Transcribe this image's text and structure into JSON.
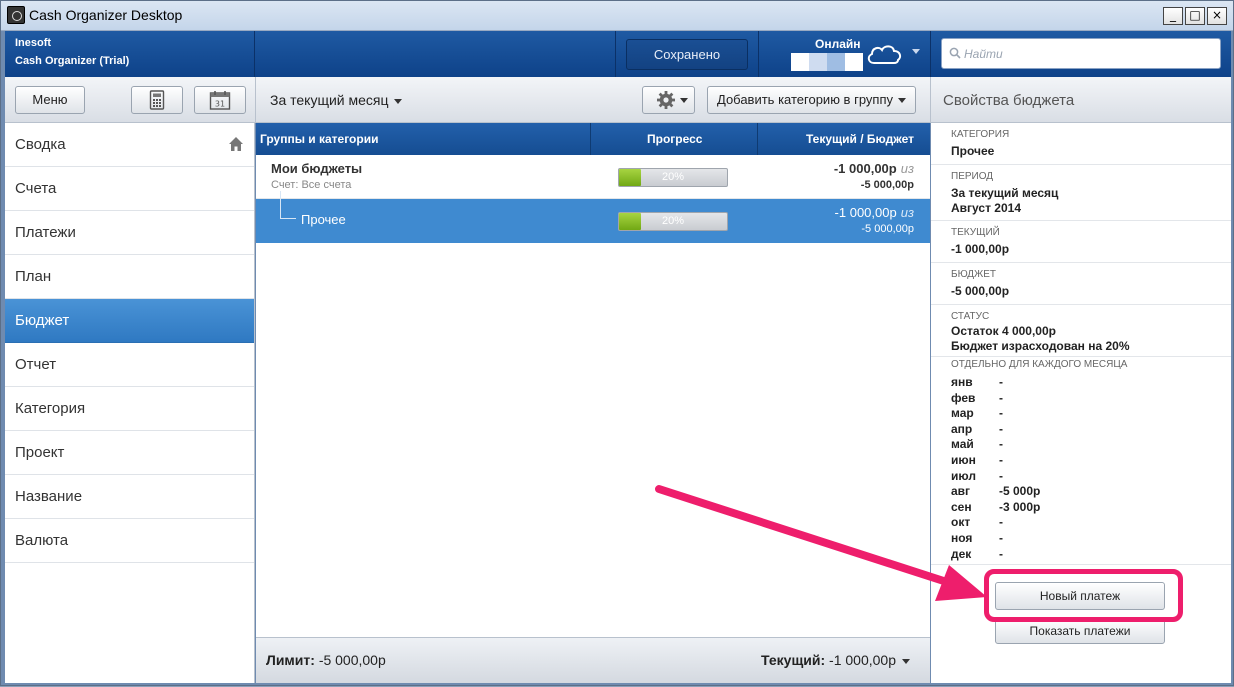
{
  "window": {
    "title": "Cash Organizer Desktop",
    "minimize": "_",
    "maximize": "□",
    "close": "×"
  },
  "header": {
    "brand_line1": "Inesoft",
    "brand_line2": "Cash Organizer (Trial)",
    "saved_label": "Сохранено",
    "online_label": "Онлайн",
    "search_placeholder": "Найти"
  },
  "toolbar": {
    "menu_label": "Меню",
    "period_label": "За текущий месяц",
    "add_category_label": "Добавить категорию в группу",
    "properties_title": "Свойства бюджета"
  },
  "sidebar": {
    "items": [
      {
        "label": "Сводка"
      },
      {
        "label": "Счета"
      },
      {
        "label": "Платежи"
      },
      {
        "label": "План"
      },
      {
        "label": "Бюджет"
      },
      {
        "label": "Отчет"
      },
      {
        "label": "Категория"
      },
      {
        "label": "Проект"
      },
      {
        "label": "Название"
      },
      {
        "label": "Валюта"
      }
    ],
    "active_index": 4
  },
  "table": {
    "columns": [
      "Группы и категории",
      "Прогресс",
      "Текущий / Бюджет"
    ],
    "rows": [
      {
        "title": "Мои бюджеты",
        "subtitle": "Счет: Все счета",
        "progress": 20,
        "progress_text": "20%",
        "current": "-1 000,00р",
        "of": "из",
        "budget": "-5 000,00р"
      },
      {
        "title": "Прочее",
        "progress": 20,
        "progress_text": "20%",
        "current": "-1 000,00р",
        "of": "из",
        "budget": "-5 000,00р"
      }
    ]
  },
  "footer": {
    "limit_label": "Лимит:",
    "limit_value": "-5 000,00р",
    "current_label": "Текущий:",
    "current_value": "-1 000,00р"
  },
  "properties": {
    "category_label": "Категория",
    "category_value": "Прочее",
    "period_label": "Период",
    "period_value_1": "За текущий месяц",
    "period_value_2": "Август 2014",
    "current_label": "Текущий",
    "current_value": "-1 000,00р",
    "budget_label": "Бюджет",
    "budget_value": "-5 000,00р",
    "status_label": "Статус",
    "status_value_1": "Остаток 4 000,00р",
    "status_value_2": "Бюджет израсходован на 20%",
    "monthly_label": "Отдельно для каждого месяца",
    "months": [
      {
        "m": "янв",
        "v": "-"
      },
      {
        "m": "фев",
        "v": "-"
      },
      {
        "m": "мар",
        "v": "-"
      },
      {
        "m": "апр",
        "v": "-"
      },
      {
        "m": "май",
        "v": "-"
      },
      {
        "m": "июн",
        "v": "-"
      },
      {
        "m": "июл",
        "v": "-"
      },
      {
        "m": "авг",
        "v": "-5 000р"
      },
      {
        "m": "сен",
        "v": "-3 000р"
      },
      {
        "m": "окт",
        "v": "-"
      },
      {
        "m": "ноя",
        "v": "-"
      },
      {
        "m": "дек",
        "v": "-"
      }
    ],
    "new_payment_label": "Новый платеж",
    "show_payments_label": "Показать платежи"
  },
  "colors": {
    "header_blue": "#154d92",
    "active_nav": "#3f8ad0",
    "highlight": "#ee1e6c",
    "progress_green": "#8cc22a"
  }
}
